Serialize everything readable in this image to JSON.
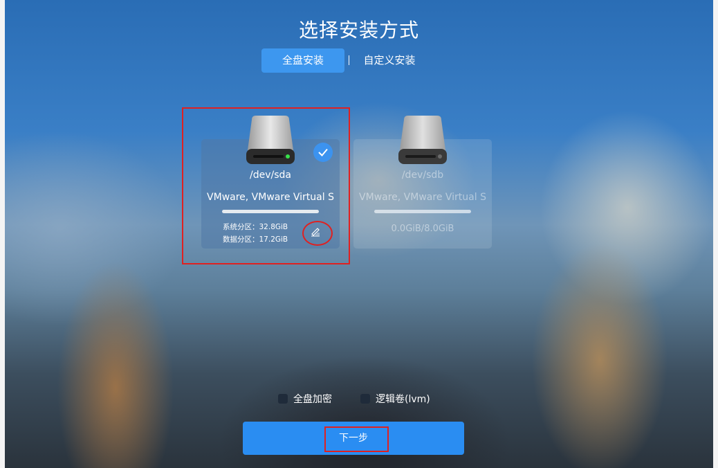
{
  "title": "选择安装方式",
  "tabs": {
    "full": "全盘安装",
    "custom": "自定义安装"
  },
  "disks": [
    {
      "device": "/dev/sda",
      "model": "VMware, VMware Virtual S",
      "selected": true,
      "system_partition": "系统分区：32.8GiB",
      "data_partition": "数据分区：17.2GiB",
      "icons": [
        "drive-icon",
        "check-icon",
        "edit-icon"
      ]
    },
    {
      "device": "/dev/sdb",
      "model": "VMware, VMware Virtual S",
      "selected": false,
      "capacity": "0.0GiB/8.0GiB",
      "icons": [
        "drive-icon"
      ]
    }
  ],
  "options": {
    "encrypt": "全盘加密",
    "lvm": "逻辑卷(lvm)"
  },
  "next_button": "下一步",
  "colors": {
    "accent": "#3d97ef",
    "button": "#2a8df2",
    "annotation": "#e02020"
  }
}
